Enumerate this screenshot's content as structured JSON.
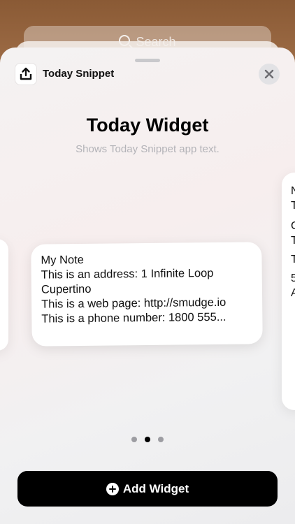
{
  "background": {
    "search_label": "Search"
  },
  "header": {
    "app_name": "Today Snippet",
    "icons": {
      "app": "share-upload-icon",
      "close": "close-icon"
    }
  },
  "gallery": {
    "title": "Today Widget",
    "subtitle": "Shows Today Snippet app text."
  },
  "widget": {
    "lines": [
      "My Note",
      "This is an address: 1 Infinite Loop",
      "Cupertino",
      "This is a web page: http://smudge.io",
      "This is a phone number: 1800 555..."
    ]
  },
  "next_widget_fragments": [
    "N",
    "T",
    "C",
    "T",
    "T",
    "5",
    "A"
  ],
  "pagination": {
    "pages": 3,
    "current": 2
  },
  "actions": {
    "add_widget_label": "Add Widget"
  },
  "colors": {
    "button_bg": "#000000",
    "button_text": "#ffffff",
    "subtitle": "#b3b3b8"
  }
}
